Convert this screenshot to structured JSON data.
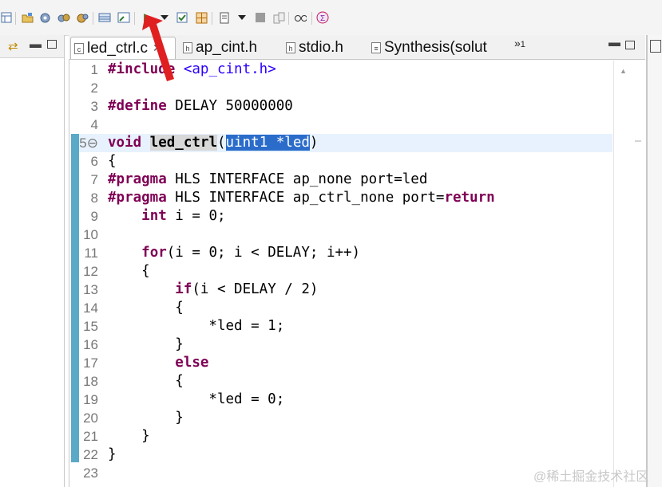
{
  "toolbar": {
    "icons": [
      "layout-icon",
      "new-project-icon",
      "settings-icon",
      "synthesis-settings-icon",
      "export-icon",
      "solution-icon",
      "console-icon",
      "run-icon",
      "run-dropdown-icon",
      "checkbox-icon",
      "grid-icon",
      "save-icon",
      "save-dropdown-icon",
      "stop-icon",
      "compare-icon",
      "glasses-icon",
      "help-icon"
    ]
  },
  "tabs": [
    {
      "label": "led_ctrl.c",
      "active": true
    },
    {
      "label": "ap_cint.h",
      "active": false
    },
    {
      "label": "stdio.h",
      "active": false
    },
    {
      "label": "Synthesis(solut",
      "active": false
    }
  ],
  "tab_overflow_count": "1",
  "code_lines": [
    {
      "n": "1",
      "html": "<span class=\"kw\">#include</span> <span class=\"str\">&lt;ap_cint.h&gt;</span>"
    },
    {
      "n": "2",
      "html": ""
    },
    {
      "n": "3",
      "html": "<span class=\"kw\">#define</span> DELAY 50000000"
    },
    {
      "n": "4",
      "html": ""
    },
    {
      "n": "5⊖",
      "html": "<span class=\"kw\">void</span> <span class=\"hl1\"><b>led_ctrl</b></span>(<span class=\"hl2\">uint1 *led</span>)"
    },
    {
      "n": "6",
      "html": "{"
    },
    {
      "n": "7",
      "html": "<span class=\"kw\">#pragma</span> HLS INTERFACE ap_none port=led"
    },
    {
      "n": "8",
      "html": "<span class=\"kw\">#pragma</span> HLS INTERFACE ap_ctrl_none port=<span class=\"kw\">return</span>"
    },
    {
      "n": "9",
      "html": "    <span class=\"kw\">int</span> i = 0;"
    },
    {
      "n": "10",
      "html": ""
    },
    {
      "n": "11",
      "html": "    <span class=\"kw\">for</span>(i = 0; i &lt; DELAY; i++)"
    },
    {
      "n": "12",
      "html": "    {"
    },
    {
      "n": "13",
      "html": "        <span class=\"kw\">if</span>(i &lt; DELAY / 2)"
    },
    {
      "n": "14",
      "html": "        {"
    },
    {
      "n": "15",
      "html": "            *led = 1;"
    },
    {
      "n": "16",
      "html": "        }"
    },
    {
      "n": "17",
      "html": "        <span class=\"kw\">else</span>"
    },
    {
      "n": "18",
      "html": "        {"
    },
    {
      "n": "19",
      "html": "            *led = 0;"
    },
    {
      "n": "20",
      "html": "        }"
    },
    {
      "n": "21",
      "html": "    }"
    },
    {
      "n": "22",
      "html": "}"
    },
    {
      "n": "23",
      "html": ""
    }
  ],
  "current_line_index": 4,
  "watermark": "@稀土掘金技术社区",
  "colors": {
    "keyword": "#7f0055",
    "string": "#2a00ff",
    "selection": "#2b6ccb",
    "gutter": "#5aa9c7",
    "arrow": "#e02020"
  }
}
